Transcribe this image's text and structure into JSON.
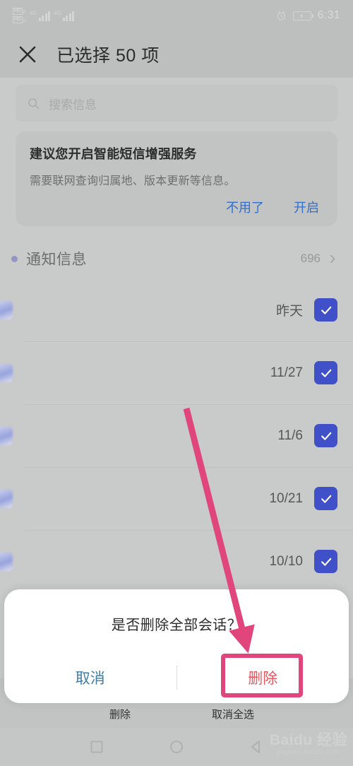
{
  "status_bar": {
    "volte_primary": "HD",
    "volte_secondary": "HD",
    "network_1": "4G",
    "network_2": "4G",
    "alarm_icon": "alarm-clock-icon",
    "battery_icon": "battery-charging-icon",
    "time": "6:31"
  },
  "app_bar": {
    "close_icon": "close-icon",
    "title": "已选择 50 项"
  },
  "search": {
    "icon": "search-icon",
    "placeholder": "搜索信息"
  },
  "promo": {
    "title": "建议您开启智能短信增强服务",
    "subtitle": "需要联网查询归属地、版本更新等信息。",
    "dismiss_label": "不用了",
    "enable_label": "开启",
    "link_color": "#2e6fd0"
  },
  "section": {
    "dot_color": "#9396c5",
    "title": "通知信息",
    "count": "696",
    "chevron_icon": "chevron-right-icon"
  },
  "messages": [
    {
      "date": "昨天",
      "checked": true,
      "body_highlight": false
    },
    {
      "date": "11/27",
      "checked": true,
      "body_highlight": true
    },
    {
      "date": "11/6",
      "checked": true,
      "body_highlight": false
    },
    {
      "date": "10/21",
      "checked": true,
      "body_highlight": true
    },
    {
      "date": "10/10",
      "checked": true,
      "body_highlight": false
    }
  ],
  "checkbox": {
    "color": "#3f50c8",
    "icon": "checkmark-icon"
  },
  "dialog": {
    "message": "是否删除全部会话？",
    "cancel_label": "取消",
    "confirm_label": "删除",
    "cancel_color": "#3b7ea8",
    "confirm_color": "#e8575f"
  },
  "bottom_toolbar": [
    {
      "icon": "trash-icon",
      "label": "删除"
    },
    {
      "icon": "deselect-all-icon",
      "label": "取消全选"
    }
  ],
  "nav_bar": [
    {
      "icon": "recents-square-icon"
    },
    {
      "icon": "home-circle-icon"
    },
    {
      "icon": "back-triangle-icon"
    }
  ],
  "annotation": {
    "arrow_icon": "pointer-arrow-icon",
    "highlight_icon": "highlight-rectangle",
    "color": "#e0457b"
  },
  "watermark": {
    "main": "Baidu 经验",
    "sub": "jingyan.baidu.com"
  }
}
